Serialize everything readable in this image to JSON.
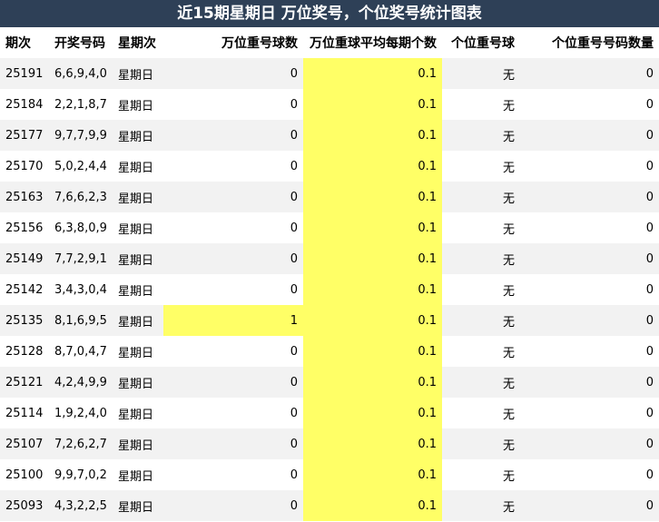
{
  "title": "近15期星期日 万位奖号，个位奖号统计图表",
  "headers": [
    "期次",
    "开奖号码",
    "星期次",
    "万位重号球数",
    "万位重球平均每期个数",
    "个位重号球",
    "个位重号号码数量"
  ],
  "highlight_color": "#ffff66",
  "header_bg": "#2e4057",
  "rows": [
    {
      "qi": "25191",
      "haoma": "6,6,9,4,0",
      "xingqi": "星期日",
      "wan": "0",
      "avg": "0.1",
      "ge": "无",
      "ge_count": "0"
    },
    {
      "qi": "25184",
      "haoma": "2,2,1,8,7",
      "xingqi": "星期日",
      "wan": "0",
      "avg": "0.1",
      "ge": "无",
      "ge_count": "0"
    },
    {
      "qi": "25177",
      "haoma": "9,7,7,9,9",
      "xingqi": "星期日",
      "wan": "0",
      "avg": "0.1",
      "ge": "无",
      "ge_count": "0"
    },
    {
      "qi": "25170",
      "haoma": "5,0,2,4,4",
      "xingqi": "星期日",
      "wan": "0",
      "avg": "0.1",
      "ge": "无",
      "ge_count": "0"
    },
    {
      "qi": "25163",
      "haoma": "7,6,6,2,3",
      "xingqi": "星期日",
      "wan": "0",
      "avg": "0.1",
      "ge": "无",
      "ge_count": "0"
    },
    {
      "qi": "25156",
      "haoma": "6,3,8,0,9",
      "xingqi": "星期日",
      "wan": "0",
      "avg": "0.1",
      "ge": "无",
      "ge_count": "0"
    },
    {
      "qi": "25149",
      "haoma": "7,7,2,9,1",
      "xingqi": "星期日",
      "wan": "0",
      "avg": "0.1",
      "ge": "无",
      "ge_count": "0"
    },
    {
      "qi": "25142",
      "haoma": "3,4,3,0,4",
      "xingqi": "星期日",
      "wan": "0",
      "avg": "0.1",
      "ge": "无",
      "ge_count": "0"
    },
    {
      "qi": "25135",
      "haoma": "8,1,6,9,5",
      "xingqi": "星期日",
      "wan": "1",
      "avg": "0.1",
      "ge": "无",
      "ge_count": "0",
      "wan_highlight": true
    },
    {
      "qi": "25128",
      "haoma": "8,7,0,4,7",
      "xingqi": "星期日",
      "wan": "0",
      "avg": "0.1",
      "ge": "无",
      "ge_count": "0"
    },
    {
      "qi": "25121",
      "haoma": "4,2,4,9,9",
      "xingqi": "星期日",
      "wan": "0",
      "avg": "0.1",
      "ge": "无",
      "ge_count": "0"
    },
    {
      "qi": "25114",
      "haoma": "1,9,2,4,0",
      "xingqi": "星期日",
      "wan": "0",
      "avg": "0.1",
      "ge": "无",
      "ge_count": "0"
    },
    {
      "qi": "25107",
      "haoma": "7,2,6,2,7",
      "xingqi": "星期日",
      "wan": "0",
      "avg": "0.1",
      "ge": "无",
      "ge_count": "0"
    },
    {
      "qi": "25100",
      "haoma": "9,9,7,0,2",
      "xingqi": "星期日",
      "wan": "0",
      "avg": "0.1",
      "ge": "无",
      "ge_count": "0"
    },
    {
      "qi": "25093",
      "haoma": "4,3,2,2,5",
      "xingqi": "星期日",
      "wan": "0",
      "avg": "0.1",
      "ge": "无",
      "ge_count": "0"
    }
  ]
}
